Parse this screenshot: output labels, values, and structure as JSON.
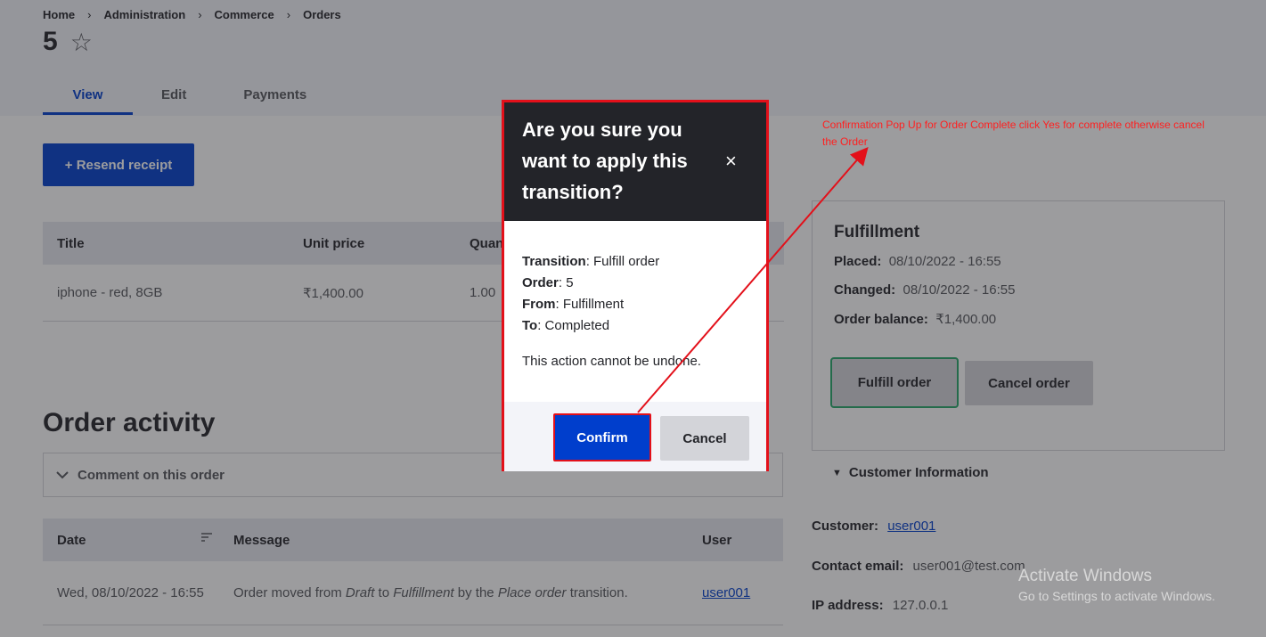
{
  "breadcrumb": [
    "Home",
    "Administration",
    "Commerce",
    "Orders"
  ],
  "breadcrumb_sep": "›",
  "page": {
    "title": "5",
    "star": "☆"
  },
  "tabs": [
    {
      "label": "View",
      "active": true
    },
    {
      "label": "Edit",
      "active": false
    },
    {
      "label": "Payments",
      "active": false
    }
  ],
  "resend_button": "+ Resend receipt",
  "items_table": {
    "headers": [
      "Title",
      "Unit price",
      "Quan"
    ],
    "rows": [
      {
        "title": "iphone - red, 8GB",
        "price": "₹1,400.00",
        "qty": "1.00"
      }
    ]
  },
  "order_activity": {
    "heading": "Order activity",
    "comment_label": "Comment on this order",
    "comment_icon": "chevron-down-icon",
    "headers": {
      "date": "Date",
      "message": "Message",
      "user": "User"
    },
    "sort_icon": "sort-icon",
    "rows": [
      {
        "date": "Wed, 08/10/2022 - 16:55",
        "msg_prefix": "Order moved from ",
        "msg_from": "Draft",
        "msg_mid": " to ",
        "msg_to": "Fulfillment",
        "msg_by": " by the ",
        "msg_transition": "Place order",
        "msg_suffix": " transition.",
        "user": "user001"
      }
    ]
  },
  "side_card": {
    "title": "Fulfillment",
    "placed_label": "Placed:",
    "placed_value": "08/10/2022 - 16:55",
    "changed_label": "Changed:",
    "changed_value": "08/10/2022 - 16:55",
    "balance_label": "Order balance:",
    "balance_value": "₹1,400.00",
    "fulfill_button": "Fulfill order",
    "cancel_button": "Cancel order"
  },
  "customer": {
    "summary_icon": "▼",
    "summary": "Customer Information",
    "customer_label": "Customer:",
    "customer_value": "user001",
    "email_label": "Contact email:",
    "email_value": "user001@test.com",
    "ip_label": "IP address:",
    "ip_value": "127.0.0.1"
  },
  "modal": {
    "title": "Are you sure you want to apply this transition?",
    "close": "×",
    "transition_label": "Transition",
    "transition_value": ": Fulfill order",
    "order_label": "Order",
    "order_value": ": 5",
    "from_label": "From",
    "from_value": ": Fulfillment",
    "to_label": "To",
    "to_value": ": Completed",
    "note": "This action cannot be undone.",
    "confirm": "Confirm",
    "cancel": "Cancel"
  },
  "annotation": "Confirmation Pop Up for Order Complete click Yes for complete otherwise cancel the Order",
  "watermark": {
    "line1": "Activate Windows",
    "line2": "Go to Settings to activate Windows."
  },
  "colors": {
    "accent": "#003ecc",
    "highlight": "#e3101a",
    "success": "#26a769"
  }
}
